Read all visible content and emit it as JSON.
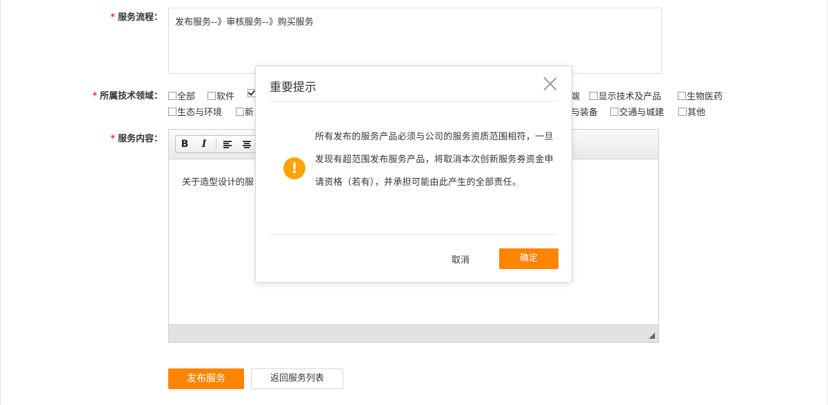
{
  "form": {
    "required_mark": "*",
    "process_label": "服务流程：",
    "process_value": "发布服务--》审核服务--》购买服务",
    "field_label": "所属技术领域：",
    "content_label": "服务内容：",
    "fields_row1": [
      {
        "label": "全部",
        "checked": false
      },
      {
        "label": "软件",
        "checked": false
      },
      {
        "label": "",
        "checked": true
      },
      {
        "label": "端",
        "checked": false
      },
      {
        "label": "显示技术及产品",
        "checked": false
      },
      {
        "label": "生物医药",
        "checked": false
      }
    ],
    "fields_row2": [
      {
        "label": "生态与环境",
        "checked": false
      },
      {
        "label": "新",
        "checked": false
      },
      {
        "label": "与装备",
        "checked": false
      },
      {
        "label": "交通与城建",
        "checked": false
      },
      {
        "label": "其他",
        "checked": false
      }
    ]
  },
  "editor": {
    "bold_label": "B",
    "italic_label": "I",
    "content": "关于造型设计的服"
  },
  "actions": {
    "publish_label": "发布服务",
    "back_label": "返回服务列表"
  },
  "modal": {
    "title": "重要提示",
    "icon_glyph": "!",
    "message": "所有发布的服务产品必须与公司的服务资质范围相符，一旦发现有超范围发布服务产品，将取消本次创新服务券资金申请资格（若有），并承担可能由此产生的全部责任。",
    "cancel_label": "取消",
    "ok_label": "确定"
  }
}
